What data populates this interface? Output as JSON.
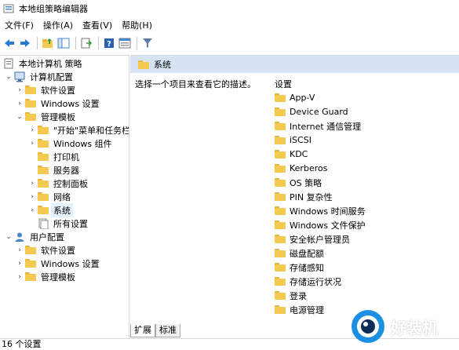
{
  "window": {
    "title": "本地组策略编辑器"
  },
  "menu": [
    "文件(F)",
    "操作(A)",
    "查看(V)",
    "帮助(H)"
  ],
  "toolbar": {
    "icons": [
      "back-arrow-icon",
      "forward-arrow-icon",
      "up-folder-icon",
      "show-hide-tree-icon",
      "export-list-icon",
      "help-icon",
      "properties-pane-icon",
      "filter-icon"
    ]
  },
  "tree": {
    "root": "本地计算机 策略",
    "computer_config": "计算机配置",
    "cc_software": "软件设置",
    "cc_windows": "Windows 设置",
    "cc_admin": "管理模板",
    "start_menu": "\"开始\"菜单和任务栏",
    "win_components": "Windows 组件",
    "printers": "打印机",
    "server": "服务器",
    "control_panel": "控制面板",
    "network": "网络",
    "system": "系统",
    "all_settings": "所有设置",
    "user_config": "用户配置",
    "uc_software": "软件设置",
    "uc_windows": "Windows 设置",
    "uc_admin": "管理模板"
  },
  "right_pane": {
    "header": "系统",
    "description": "选择一个项目来查看它的描述。",
    "column_header": "设置",
    "items": [
      "App-V",
      "Device Guard",
      "Internet 通信管理",
      "iSCSI",
      "KDC",
      "Kerberos",
      "OS 策略",
      "PIN 复杂性",
      "Windows 时间服务",
      "Windows 文件保护",
      "安全帐户管理员",
      "磁盘配额",
      "存储感知",
      "存储运行状况",
      "登录",
      "电源管理"
    ]
  },
  "tabs": [
    "扩展",
    "标准"
  ],
  "status": "16 个设置",
  "watermark": "好装机",
  "colors": {
    "header_bg": "#d6e3f3",
    "selection_bg": "#e5f1fb",
    "folder": "#f4c94f"
  }
}
